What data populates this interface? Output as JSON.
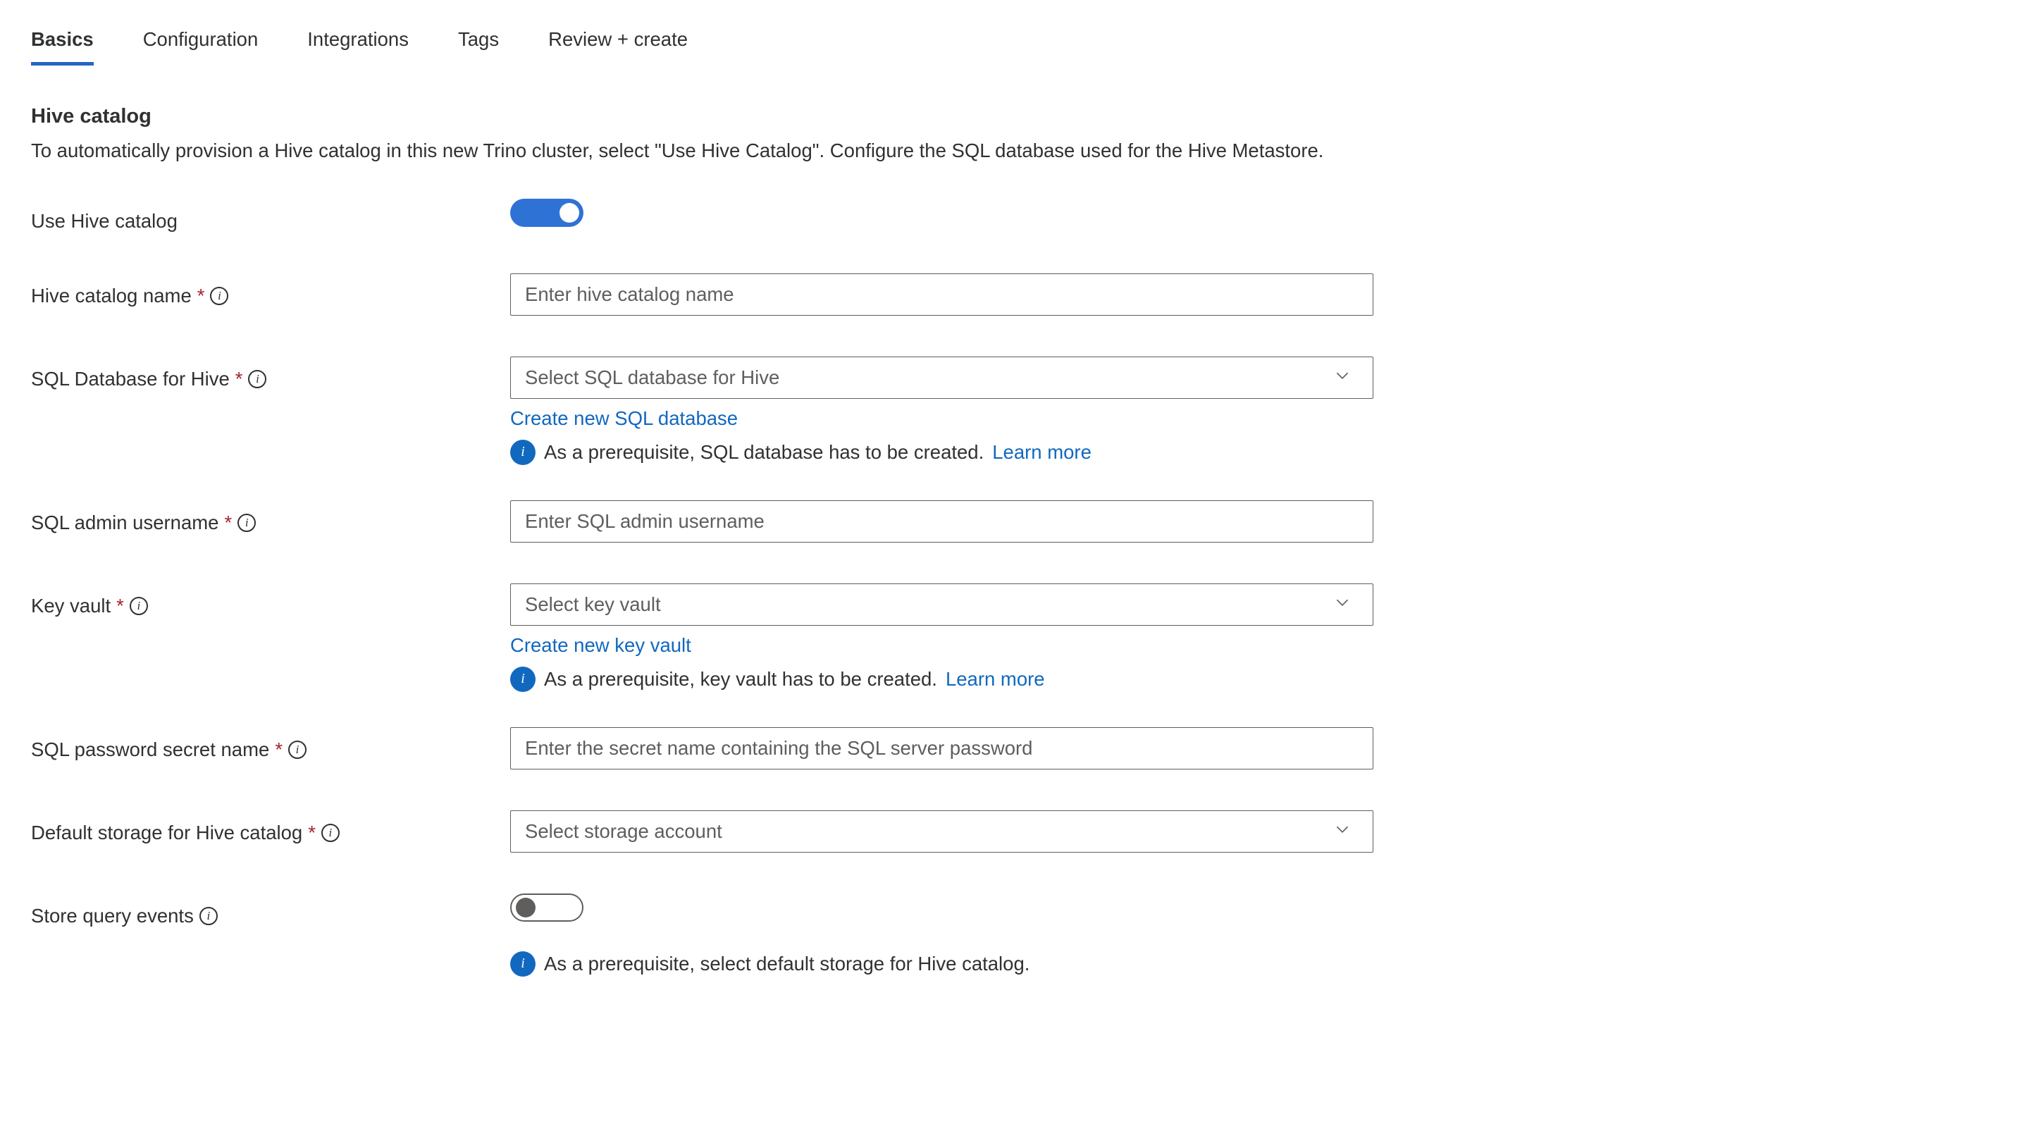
{
  "tabs": {
    "basics": "Basics",
    "configuration": "Configuration",
    "integrations": "Integrations",
    "tags": "Tags",
    "review": "Review + create"
  },
  "section": {
    "title": "Hive catalog",
    "description": "To automatically provision a Hive catalog in this new Trino cluster, select \"Use Hive Catalog\". Configure the SQL database used for the Hive Metastore."
  },
  "fields": {
    "useHive": {
      "label": "Use Hive catalog"
    },
    "catalogName": {
      "label": "Hive catalog name",
      "placeholder": "Enter hive catalog name"
    },
    "sqlDb": {
      "label": "SQL Database for Hive",
      "placeholder": "Select SQL database for Hive",
      "createLink": "Create new SQL database",
      "prereq": "As a prerequisite, SQL database has to be created.",
      "learn": "Learn more"
    },
    "sqlAdmin": {
      "label": "SQL admin username",
      "placeholder": "Enter SQL admin username"
    },
    "keyVault": {
      "label": "Key vault",
      "placeholder": "Select key vault",
      "createLink": "Create new key vault",
      "prereq": "As a prerequisite, key vault has to be created.",
      "learn": "Learn more"
    },
    "secretName": {
      "label": "SQL password secret name",
      "placeholder": "Enter the secret name containing the SQL server password"
    },
    "defaultStorage": {
      "label": "Default storage for Hive catalog",
      "placeholder": "Select storage account"
    },
    "storeEvents": {
      "label": "Store query events",
      "prereq": "As a prerequisite, select default storage for Hive catalog."
    }
  }
}
